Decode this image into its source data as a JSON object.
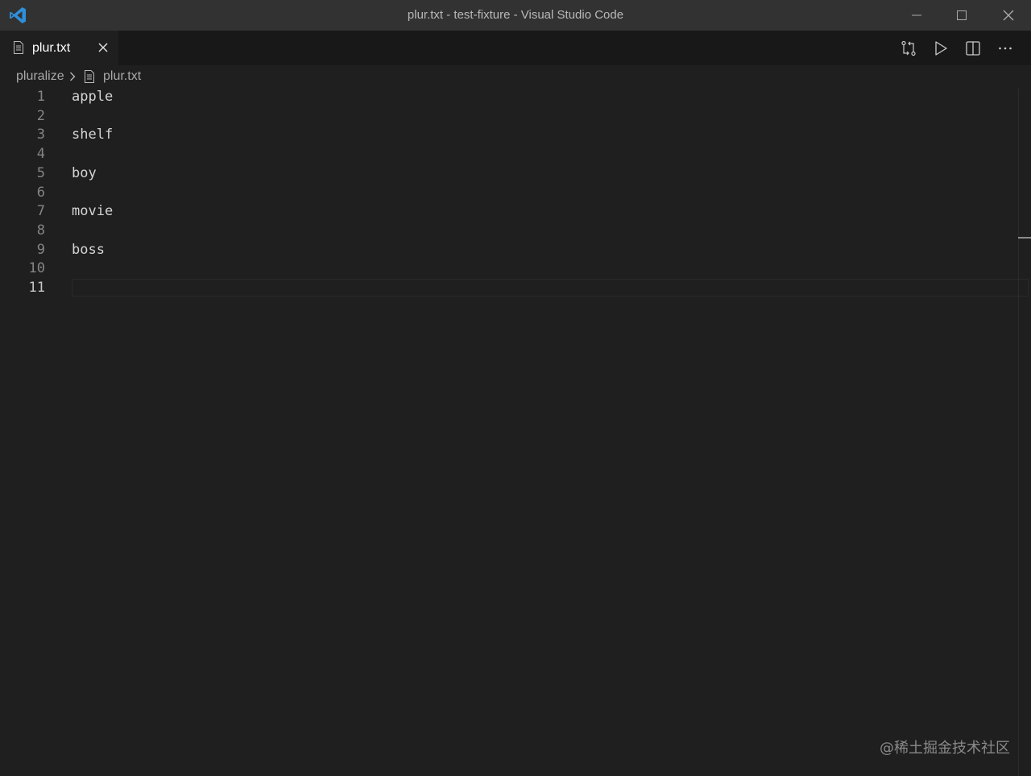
{
  "window": {
    "title": "plur.txt - test-fixture - Visual Studio Code",
    "logo_icon": "vscode-logo-icon",
    "controls": [
      "minimize-icon",
      "maximize-icon",
      "close-icon"
    ]
  },
  "tabs": [
    {
      "label": "plur.txt",
      "icon": "file-text-icon",
      "active": true
    }
  ],
  "editor_actions": [
    "compare-changes-icon",
    "run-icon",
    "split-editor-icon",
    "more-actions-icon"
  ],
  "breadcrumb": {
    "folder": "pluralize",
    "file": "plur.txt"
  },
  "editor": {
    "line_numbers": [
      "1",
      "2",
      "3",
      "4",
      "5",
      "6",
      "7",
      "8",
      "9",
      "10",
      "11"
    ],
    "lines": [
      "apple",
      "",
      "shelf",
      "",
      "boy",
      "",
      "movie",
      "",
      "boss",
      "",
      ""
    ],
    "current_line": "11"
  },
  "watermark": "@稀土掘金技术社区",
  "colors": {
    "titlebar": "#323233",
    "editor_bg": "#1f1f1f",
    "tab_bg": "#181818",
    "accent_logo": "#2f8fd8"
  }
}
